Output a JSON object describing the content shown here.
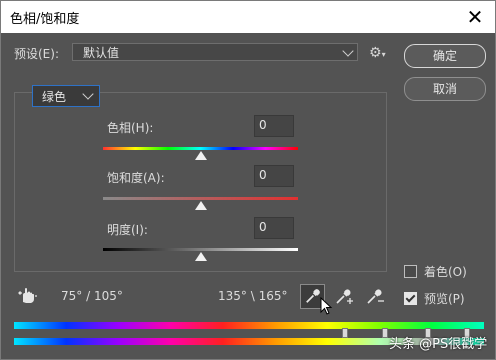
{
  "window": {
    "title": "色相/饱和度",
    "close_glyph": "✕"
  },
  "preset": {
    "label": "预设(E):",
    "value": "默认值"
  },
  "buttons": {
    "ok": "确定",
    "cancel": "取消"
  },
  "channel": {
    "value": "绿色"
  },
  "hue": {
    "label": "色相(H):",
    "value": "0",
    "level_percent": 50
  },
  "saturation": {
    "label": "饱和度(A):",
    "value": "0",
    "level_percent": 50
  },
  "lightness": {
    "label": "明度(I):",
    "value": "0",
    "level_percent": 50
  },
  "range": {
    "left": "75° / 105°",
    "right": "135° \\ 165°"
  },
  "options": {
    "colorize": {
      "label": "着色(O)",
      "checked": false
    },
    "preview": {
      "label": "预览(P)",
      "checked": true
    }
  },
  "icons": {
    "gear": "gear-icon",
    "hand": "on-image-adjust-icon",
    "eyedropper": "eyedropper-icon",
    "eyedropper_add": "eyedropper-plus-icon",
    "eyedropper_sub": "eyedropper-minus-icon"
  },
  "watermark": "头条 @PS很戳学"
}
